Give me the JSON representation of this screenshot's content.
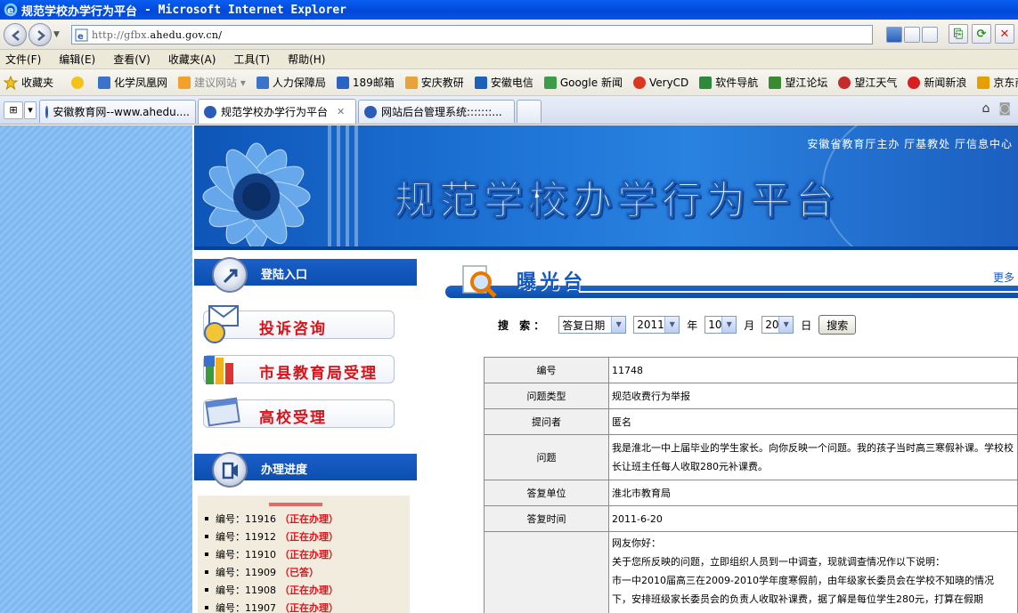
{
  "window": {
    "title": "规范学校办学行为平台",
    "app": "- Microsoft Internet Explorer"
  },
  "address": {
    "url_prefix": "http://gfbx.",
    "url_host": "ahedu.gov.cn/"
  },
  "menu": [
    "文件(F)",
    "编辑(E)",
    "查看(V)",
    "收藏夹(A)",
    "工具(T)",
    "帮助(H)"
  ],
  "favorites": {
    "label": "收藏夹",
    "items": [
      {
        "label": "化学凤凰网",
        "color": "#3a73c9",
        "muted": false
      },
      {
        "label": "建议网站 ▾",
        "color": "#f2a22b",
        "muted": true
      },
      {
        "label": "人力保障局",
        "color": "#3a73c9",
        "muted": false
      },
      {
        "label": "189邮箱",
        "color": "#2b63c4",
        "muted": false
      },
      {
        "label": "安庆教研",
        "color": "#e8a33b",
        "muted": false
      },
      {
        "label": "安徽电信",
        "color": "#1b62b8",
        "muted": false
      },
      {
        "label": "Google 新闻",
        "color": "#3b9c4a",
        "muted": false
      },
      {
        "label": "VeryCD",
        "color": "#d9371e",
        "muted": false
      },
      {
        "label": "软件导航",
        "color": "#2e8a3a",
        "muted": false
      },
      {
        "label": "望江论坛",
        "color": "#3a8a33",
        "muted": false
      },
      {
        "label": "望江天气",
        "color": "#c62a2a",
        "muted": false
      },
      {
        "label": "新闻新浪",
        "color": "#d81e1e",
        "muted": false
      },
      {
        "label": "京东商城",
        "color": "#e5a000",
        "muted": false
      }
    ]
  },
  "tabs": [
    {
      "label": "安徽教育网--www.ahedu....",
      "active": false
    },
    {
      "label": "规范学校办学行为平台",
      "active": true,
      "close": "✕"
    },
    {
      "label": "网站后台管理系统:::::::...",
      "active": false
    }
  ],
  "banner": {
    "orgs": "安徽省教育厅主办  厅基教处  厅信息中心",
    "title": "规范学校办学行为平台"
  },
  "left": {
    "login_header": "登陆入口",
    "buttons": [
      "投诉咨询",
      "市县教育局受理",
      "高校受理"
    ],
    "progress_header": "办理进度",
    "progress_prefix": "编号：",
    "progress": [
      {
        "id": "11916",
        "status": "（正在办理）"
      },
      {
        "id": "11912",
        "status": "（正在办理）"
      },
      {
        "id": "11910",
        "status": "（正在办理）"
      },
      {
        "id": "11909",
        "status": "（已答）"
      },
      {
        "id": "11908",
        "status": "（正在办理）"
      },
      {
        "id": "11907",
        "status": "（正在办理）"
      }
    ]
  },
  "exposure": {
    "title": "曝光台",
    "more": "更多"
  },
  "search": {
    "label": "搜 索：",
    "field": "答复日期",
    "year": "2011",
    "year_unit": "年",
    "month": "10",
    "month_unit": "月",
    "day": "20",
    "day_unit": "日",
    "button": "搜索"
  },
  "detail": {
    "rows": [
      {
        "k": "编号",
        "v": "11748"
      },
      {
        "k": "问题类型",
        "v": "规范收费行为举报"
      },
      {
        "k": "提问者",
        "v": "匿名"
      },
      {
        "k": "问题",
        "v": "我是淮北一中上届毕业的学生家长。向你反映一个问题。我的孩子当时高三寒假补课。学校校长让班主任每人收取280元补课费。"
      },
      {
        "k": "答复单位",
        "v": "淮北市教育局"
      },
      {
        "k": "答复时间",
        "v": "2011-6-20"
      }
    ],
    "answer_lines": [
      "网友你好：",
      "关于您所反映的问题，立即组织人员到一中调查，现就调查情况作以下说明：",
      "市一中2010届高三在2009-2010学年度寒假前，由年级家长委员会在学校不知晓的情况",
      "下，安排班级家长委员会的负责人收取补课费，据了解是每位学生280元，打算在假期"
    ]
  }
}
